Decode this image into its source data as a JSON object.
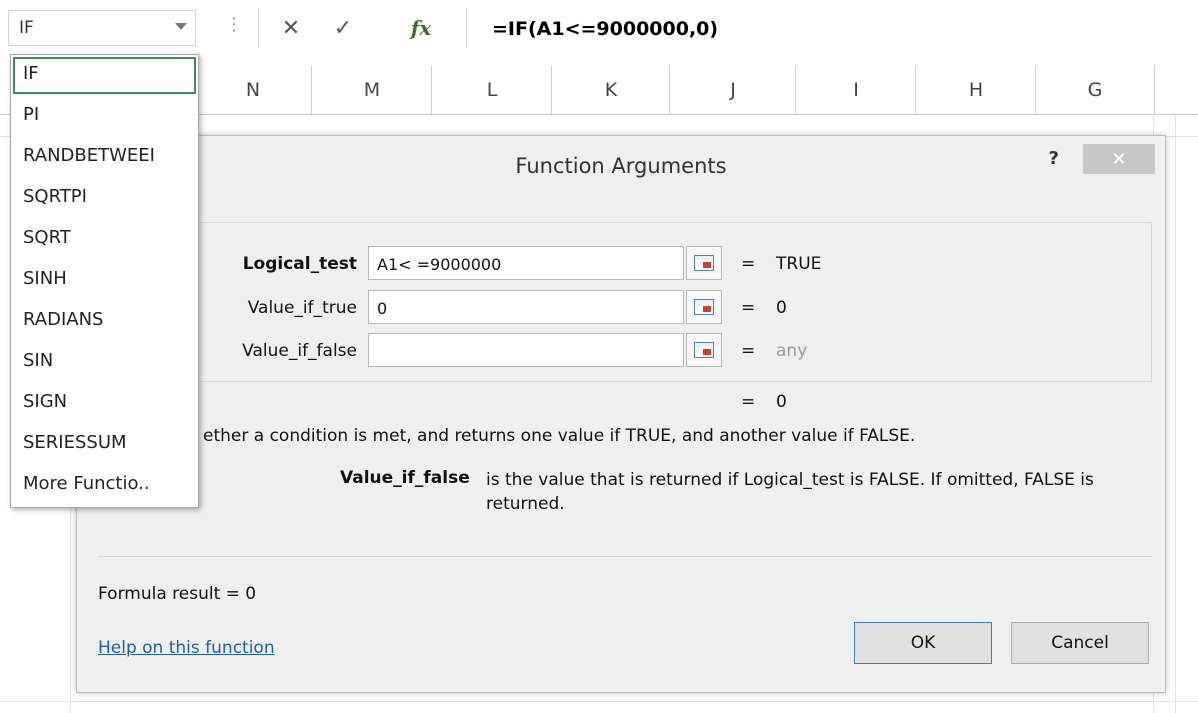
{
  "formula_bar": {
    "name_box": "IF",
    "cancel_glyph": "✕",
    "enter_glyph": "✓",
    "fx_label": "fx",
    "formula": "=IF(A1<=9000000,0)"
  },
  "columns": [
    "N",
    "M",
    "L",
    "K",
    "J",
    "I",
    "H",
    "G"
  ],
  "autocomplete": {
    "items": [
      "IF",
      "PI",
      "RANDBETWEEI",
      "SQRTPI",
      "SQRT",
      "SINH",
      "RADIANS",
      "SIN",
      "SIGN",
      "SERIESSUM",
      "More Functio.."
    ],
    "selected_index": 0
  },
  "dialog": {
    "title": "Function Arguments",
    "help_glyph": "?",
    "close_glyph": "✕",
    "args": [
      {
        "label": "Logical_test",
        "value": "A1< =9000000",
        "eq": "=",
        "result": "TRUE"
      },
      {
        "label": "Value_if_true",
        "value": "0",
        "eq": "=",
        "result": "0"
      },
      {
        "label": "Value_if_false",
        "value": "",
        "eq": "=",
        "result": "any"
      }
    ],
    "result_eq": "=",
    "result_value": "0",
    "description": "ether a condition is met, and returns one value if TRUE, and another value if FALSE.",
    "arg_desc_label": "Value_if_false",
    "arg_desc_text": "is the value that is returned if Logical_test is FALSE. If omitted, FALSE is returned.",
    "formula_result": "Formula result =   0",
    "help_link": "Help on this function",
    "ok_label": "OK",
    "cancel_label": "Cancel"
  },
  "colors": {
    "accent_link": "#1a5fb4",
    "selected_border": "#3b8e50",
    "ok_border": "#3c7fd0"
  }
}
